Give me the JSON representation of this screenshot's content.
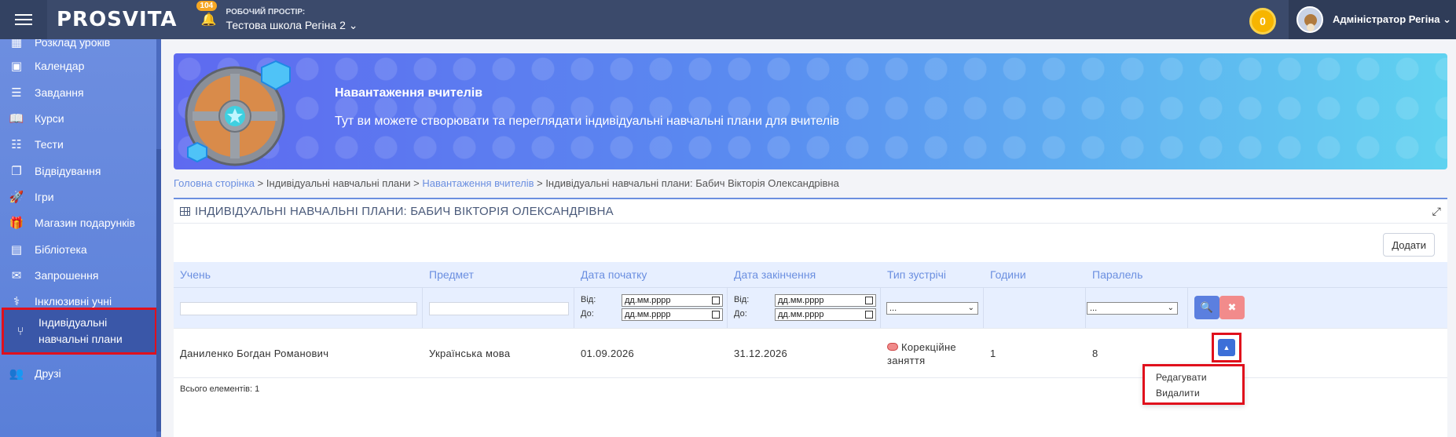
{
  "topbar": {
    "logo": "PROSVITA",
    "notifications": "104",
    "workspace_label": "РОБОЧИЙ ПРОСТІР:",
    "workspace_value": "Тестова школа Регіна 2 ⌄",
    "coins": "0",
    "user_name": "Адміністратор Регіна ⌄"
  },
  "sidebar": {
    "items": [
      {
        "label": "Розклад уроків",
        "icon": "schedule-icon"
      },
      {
        "label": "Календар",
        "icon": "calendar-icon"
      },
      {
        "label": "Завдання",
        "icon": "tasks-icon"
      },
      {
        "label": "Курси",
        "icon": "book-icon"
      },
      {
        "label": "Тести",
        "icon": "tests-icon"
      },
      {
        "label": "Відвідування",
        "icon": "attendance-icon"
      },
      {
        "label": "Ігри",
        "icon": "rocket-icon"
      },
      {
        "label": "Магазин подарунків",
        "icon": "gift-icon"
      },
      {
        "label": "Бібліотека",
        "icon": "library-icon"
      },
      {
        "label": "Запрошення",
        "icon": "envelope-icon"
      },
      {
        "label": "Інклюзивні учні",
        "icon": "stethoscope-icon"
      },
      {
        "label": "Індивідуальні навчальні плани",
        "icon": "branch-icon"
      },
      {
        "label": "Друзі",
        "icon": "friends-icon"
      }
    ]
  },
  "hero": {
    "title": "Навантаження вчителів",
    "subtitle": "Тут ви можете створювати та переглядати індивідуальні навчальні плани для вчителів"
  },
  "breadcrumb": {
    "home": "Головна сторінка",
    "sep1": " > Індивідуальні навчальні плани > ",
    "teacher_load": "Навантаження вчителів",
    "sep2": " > Індивідуальні навчальні плани: Бабич Вікторія Олександрівна"
  },
  "panel": {
    "title": "ІНДИВІДУАЛЬНІ НАВЧАЛЬНІ ПЛАНИ: БАБИЧ ВІКТОРІЯ ОЛЕКСАНДРІВНА",
    "add_label": "Додати",
    "total": "Всього елементів: 1"
  },
  "table": {
    "columns": [
      "Учень",
      "Предмет",
      "Дата початку",
      "Дата закінчення",
      "Тип зустрічі",
      "Години",
      "Паралель"
    ],
    "filters": {
      "from_label": "Від:",
      "to_label": "До:",
      "date_placeholder": "дд.мм.рррр",
      "select_value": "..."
    },
    "rows": [
      {
        "student": "Даниленко Богдан Романович",
        "subject": "Українська мова",
        "start": "01.09.2026",
        "end": "31.12.2026",
        "meeting_type_line1": "Корекційне",
        "meeting_type_line2": "заняття",
        "hours": "1",
        "parallel": "8"
      }
    ]
  },
  "dropdown": {
    "edit": "Редагувати",
    "delete": "Видалити"
  }
}
